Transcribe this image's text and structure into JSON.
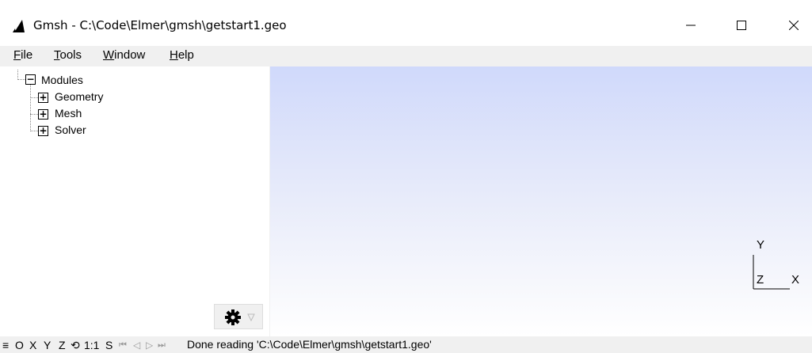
{
  "window": {
    "title": "Gmsh - C:\\Code\\Elmer\\gmsh\\getstart1.geo",
    "minimize_glyph": "—",
    "maximize_glyph": "☐",
    "close_glyph": "✕"
  },
  "menu": [
    {
      "mnemonic": "F",
      "rest": "ile"
    },
    {
      "mnemonic": "T",
      "rest": "ools"
    },
    {
      "mnemonic": "W",
      "rest": "indow"
    },
    {
      "mnemonic": "H",
      "rest": "elp"
    }
  ],
  "tree": {
    "root": {
      "label": "Modules",
      "toggle": "−"
    },
    "children": [
      {
        "label": "Geometry",
        "toggle": "+"
      },
      {
        "label": "Mesh",
        "toggle": "+"
      },
      {
        "label": "Solver",
        "toggle": "+"
      }
    ]
  },
  "viewport": {
    "axes": {
      "y": "Y",
      "z": "Z",
      "x": "X"
    }
  },
  "statusbar": {
    "menu_glyph": "≡",
    "o": "O",
    "x": "X",
    "y": "Y",
    "z": "Z",
    "rotate_glyph": "⟲",
    "scale": "1:1",
    "s": "S",
    "first_glyph": "⏮",
    "prev_glyph": "◁",
    "play_glyph": "▷",
    "next_glyph": "⏭",
    "message": "Done reading 'C:\\Code\\Elmer\\gmsh\\getstart1.geo'"
  },
  "colors": {
    "viewport_top": "#d0d9fb",
    "viewport_bottom": "#ffffff",
    "chrome": "#f0f0f0"
  }
}
